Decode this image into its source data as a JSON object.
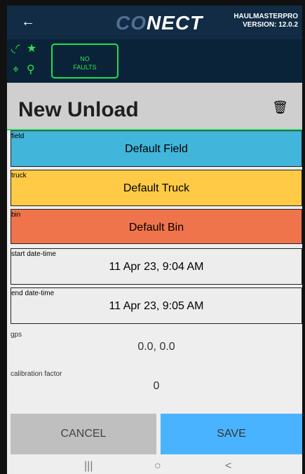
{
  "header": {
    "back_icon": "arrow-left-icon",
    "logo_prefix": "CO",
    "logo_suffix": "NECT",
    "version_line1": "HAULMASTERPRO",
    "version_line2": "VERSION: 12.0.2"
  },
  "status": {
    "icons": [
      "wifi-icon",
      "star-icon",
      "location-pin-icon",
      "person-icon"
    ],
    "fault_line1": "NO",
    "fault_line2": "FAULTS"
  },
  "screen": {
    "title": "New Unload",
    "delete_icon": "trash-icon"
  },
  "fields": [
    {
      "label": "field",
      "value": "Default Field",
      "color": "#42b5db"
    },
    {
      "label": "truck",
      "value": "Default Truck",
      "color": "#ffca46"
    },
    {
      "label": "bin",
      "value": "Default Bin",
      "color": "#f0744b"
    },
    {
      "label": "start date-time",
      "value": "11 Apr 23, 9:04 AM",
      "color": "#ededed"
    },
    {
      "label": "end date-time",
      "value": "11 Apr 23, 9:05 AM",
      "color": "#ededed"
    }
  ],
  "readonly": {
    "gps_label": "gps",
    "gps_value": "0.0, 0.0",
    "calibration_label": "calibration factor",
    "calibration_value": "0"
  },
  "actions": {
    "cancel": "CANCEL",
    "save": "SAVE"
  },
  "system_nav": {
    "recents": "|||",
    "home": "○",
    "back": "<"
  }
}
